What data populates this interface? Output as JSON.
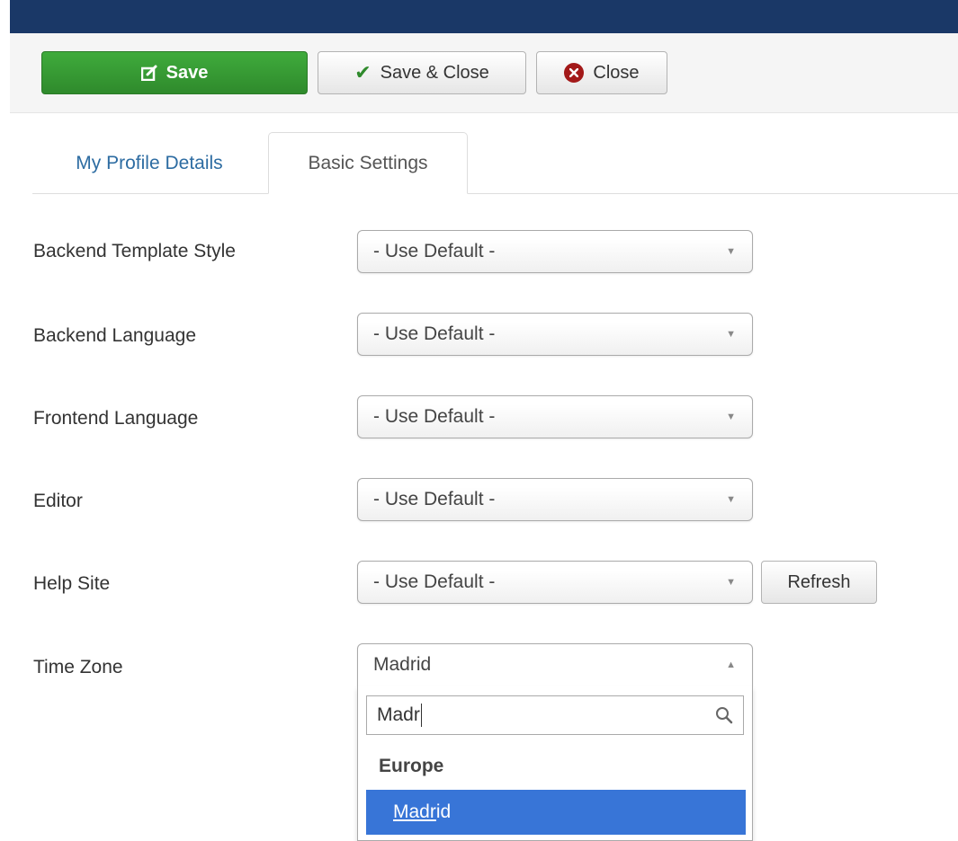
{
  "toolbar": {
    "save_label": "Save",
    "save_close_label": "Save & Close",
    "close_label": "Close"
  },
  "tabs": [
    {
      "label": "My Profile Details"
    },
    {
      "label": "Basic Settings"
    }
  ],
  "fields": [
    {
      "label": "Backend Template Style",
      "value": "- Use Default -"
    },
    {
      "label": "Backend Language",
      "value": "- Use Default -"
    },
    {
      "label": "Frontend Language",
      "value": "- Use Default -"
    },
    {
      "label": "Editor",
      "value": "- Use Default -"
    },
    {
      "label": "Help Site",
      "value": "- Use Default -"
    },
    {
      "label": "Time Zone",
      "value": "Madrid"
    }
  ],
  "refresh_label": "Refresh",
  "timezone_dropdown": {
    "search_value": "Madr",
    "group": "Europe",
    "option_match": "Madr",
    "option_rest": "id"
  },
  "colors": {
    "top_bar": "#1a3867",
    "save_button": "#2f8a2c",
    "highlight": "#3875d7",
    "tab_link": "#2d6ca2"
  }
}
